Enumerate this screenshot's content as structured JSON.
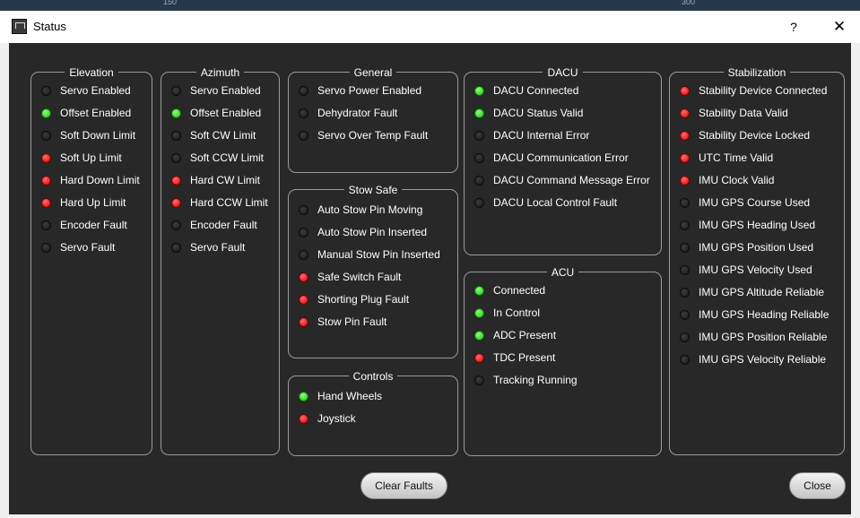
{
  "background": {
    "tick_left": "150",
    "tick_right": "300"
  },
  "window": {
    "title": "Status",
    "help_label": "?",
    "close_label": "✕"
  },
  "colors": {
    "led_green": "#1cc114",
    "led_red": "#d00000",
    "led_off": "#2a2a2a",
    "panel_bg": "#282828"
  },
  "panels": {
    "elevation": {
      "title": "Elevation",
      "items": [
        {
          "label": "Servo Enabled",
          "state": "off"
        },
        {
          "label": "Offset Enabled",
          "state": "green"
        },
        {
          "label": "Soft Down Limit",
          "state": "off"
        },
        {
          "label": "Soft Up Limit",
          "state": "red"
        },
        {
          "label": "Hard Down Limit",
          "state": "red"
        },
        {
          "label": "Hard Up Limit",
          "state": "red"
        },
        {
          "label": "Encoder Fault",
          "state": "off"
        },
        {
          "label": "Servo Fault",
          "state": "off"
        }
      ]
    },
    "azimuth": {
      "title": "Azimuth",
      "items": [
        {
          "label": "Servo Enabled",
          "state": "off"
        },
        {
          "label": "Offset Enabled",
          "state": "green"
        },
        {
          "label": "Soft CW Limit",
          "state": "off"
        },
        {
          "label": "Soft CCW Limit",
          "state": "off"
        },
        {
          "label": "Hard CW Limit",
          "state": "red"
        },
        {
          "label": "Hard CCW Limit",
          "state": "red"
        },
        {
          "label": "Encoder Fault",
          "state": "off"
        },
        {
          "label": "Servo Fault",
          "state": "off"
        }
      ]
    },
    "general": {
      "title": "General",
      "items": [
        {
          "label": "Servo Power Enabled",
          "state": "off"
        },
        {
          "label": "Dehydrator Fault",
          "state": "off"
        },
        {
          "label": "Servo Over Temp Fault",
          "state": "off"
        }
      ]
    },
    "stow_safe": {
      "title": "Stow Safe",
      "items": [
        {
          "label": "Auto Stow Pin Moving",
          "state": "off"
        },
        {
          "label": "Auto Stow Pin Inserted",
          "state": "off"
        },
        {
          "label": "Manual Stow Pin Inserted",
          "state": "off"
        },
        {
          "label": "Safe Switch Fault",
          "state": "red"
        },
        {
          "label": "Shorting Plug Fault",
          "state": "red"
        },
        {
          "label": "Stow Pin Fault",
          "state": "red"
        }
      ]
    },
    "controls": {
      "title": "Controls",
      "items": [
        {
          "label": "Hand Wheels",
          "state": "green"
        },
        {
          "label": "Joystick",
          "state": "red"
        }
      ]
    },
    "dacu": {
      "title": "DACU",
      "items": [
        {
          "label": "DACU Connected",
          "state": "green"
        },
        {
          "label": "DACU Status Valid",
          "state": "green"
        },
        {
          "label": "DACU Internal Error",
          "state": "off"
        },
        {
          "label": "DACU Communication Error",
          "state": "off"
        },
        {
          "label": "DACU Command Message Error",
          "state": "off"
        },
        {
          "label": "DACU Local Control Fault",
          "state": "off"
        }
      ]
    },
    "acu": {
      "title": "ACU",
      "items": [
        {
          "label": "Connected",
          "state": "green"
        },
        {
          "label": "In Control",
          "state": "green"
        },
        {
          "label": "ADC Present",
          "state": "green"
        },
        {
          "label": "TDC Present",
          "state": "red"
        },
        {
          "label": "Tracking Running",
          "state": "off"
        }
      ]
    },
    "stabilization": {
      "title": "Stabilization",
      "items": [
        {
          "label": "Stability Device Connected",
          "state": "red"
        },
        {
          "label": "Stability Data Valid",
          "state": "red"
        },
        {
          "label": "Stability Device Locked",
          "state": "red"
        },
        {
          "label": "UTC Time Valid",
          "state": "red"
        },
        {
          "label": "IMU Clock Valid",
          "state": "red"
        },
        {
          "label": "IMU GPS Course Used",
          "state": "off"
        },
        {
          "label": "IMU GPS Heading Used",
          "state": "off"
        },
        {
          "label": "IMU GPS Position Used",
          "state": "off"
        },
        {
          "label": "IMU GPS Velocity Used",
          "state": "off"
        },
        {
          "label": "IMU GPS Altitude Reliable",
          "state": "off"
        },
        {
          "label": "IMU GPS Heading Reliable",
          "state": "off"
        },
        {
          "label": "IMU GPS Position Reliable",
          "state": "off"
        },
        {
          "label": "IMU GPS Velocity Reliable",
          "state": "off"
        }
      ]
    }
  },
  "buttons": {
    "clear_faults": "Clear Faults",
    "close": "Close"
  }
}
